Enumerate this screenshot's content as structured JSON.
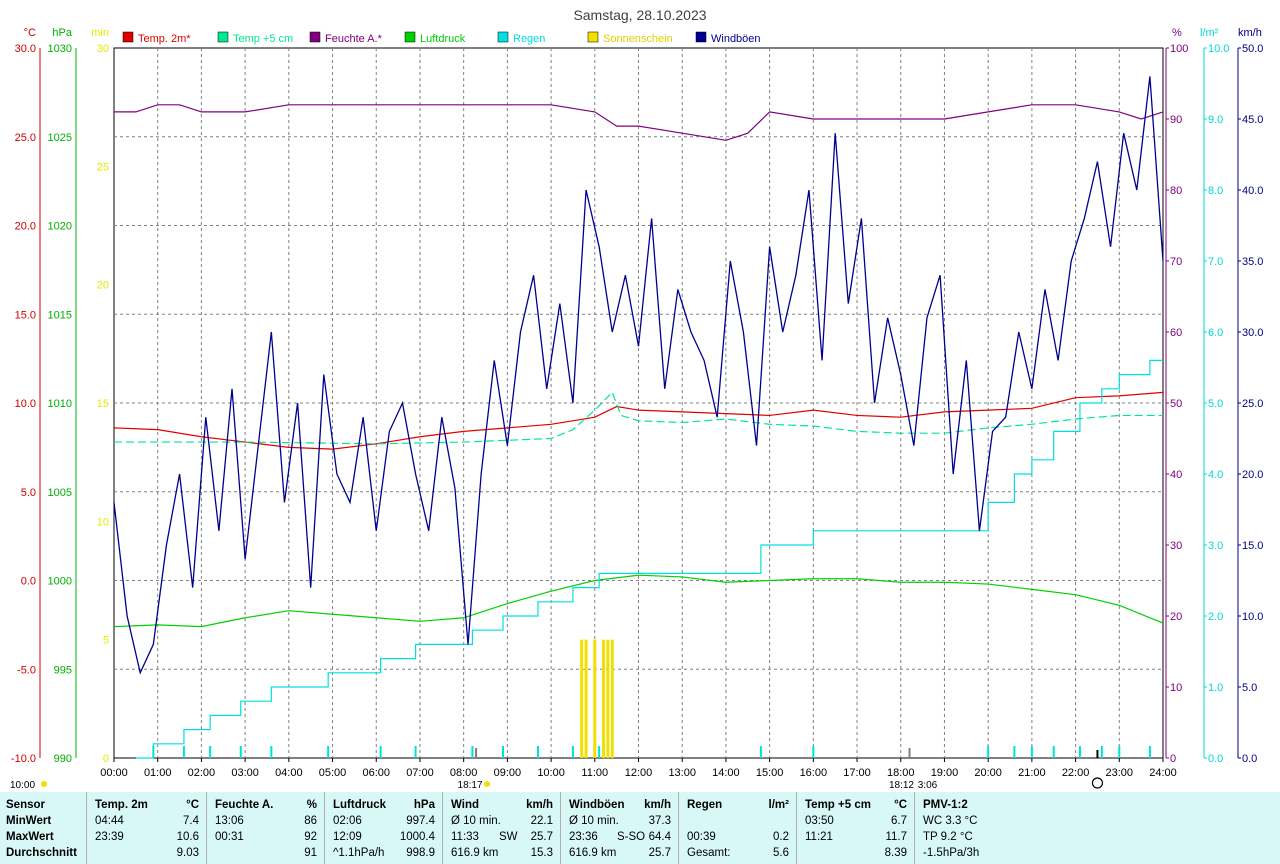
{
  "chart_data": {
    "type": "line",
    "title": "Samstag, 28.10.2023",
    "x_ticks": [
      "00:00",
      "01:00",
      "02:00",
      "03:00",
      "04:00",
      "05:00",
      "06:00",
      "07:00",
      "08:00",
      "09:00",
      "10:00",
      "11:00",
      "12:00",
      "13:00",
      "14:00",
      "15:00",
      "16:00",
      "17:00",
      "18:00",
      "19:00",
      "20:00",
      "21:00",
      "22:00",
      "23:00",
      "24:00"
    ],
    "axes": {
      "temp": {
        "unit": "°C",
        "ticks": [
          "30.0",
          "25.0",
          "20.0",
          "15.0",
          "10.0",
          "5.0",
          "0.0",
          "-5.0",
          "-10.0"
        ],
        "range": [
          -10,
          30
        ],
        "color": "#d00000"
      },
      "pressure": {
        "unit": "hPa",
        "ticks": [
          "1030",
          "1025",
          "1020",
          "1015",
          "1010",
          "1005",
          "1000",
          "995",
          "990"
        ],
        "range": [
          990,
          1030
        ],
        "color": "#00b000"
      },
      "sunshine": {
        "unit": "min",
        "ticks": [
          "30",
          "25",
          "20",
          "15",
          "10",
          "5",
          "0"
        ],
        "range": [
          0,
          30
        ],
        "color": "#e8e800"
      },
      "humidity": {
        "unit": "%",
        "ticks": [
          "100",
          "90",
          "80",
          "70",
          "60",
          "50",
          "40",
          "30",
          "20",
          "10",
          "0"
        ],
        "range": [
          0,
          100
        ],
        "color": "#800080"
      },
      "rain": {
        "unit": "l/m²",
        "ticks": [
          "10.0",
          "9.0",
          "8.0",
          "7.0",
          "6.0",
          "5.0",
          "4.0",
          "3.0",
          "2.0",
          "1.0",
          "0.0"
        ],
        "range": [
          0,
          10
        ],
        "color": "#00d8d8"
      },
      "wind": {
        "unit": "km/h",
        "ticks": [
          "50.0",
          "45.0",
          "40.0",
          "35.0",
          "30.0",
          "25.0",
          "20.0",
          "15.0",
          "10.0",
          "5.0",
          "0.0"
        ],
        "range": [
          0,
          50
        ],
        "color": "#000080"
      }
    },
    "legend": [
      {
        "name": "Temp. 2m*",
        "color": "#e00000"
      },
      {
        "name": "Temp +5 cm",
        "color": "#00e890"
      },
      {
        "name": "Feuchte A.*",
        "color": "#800080"
      },
      {
        "name": "Luftdruck",
        "color": "#00d000"
      },
      {
        "name": "Regen",
        "color": "#00e0e0"
      },
      {
        "name": "Sonnenschein",
        "color": "#f0e000"
      },
      {
        "name": "Windböen",
        "color": "#000090"
      }
    ],
    "series": [
      {
        "name": "Temp. 2m*",
        "axis": "temp",
        "x": [
          0,
          1,
          2,
          3,
          4,
          5,
          6,
          7,
          8,
          9,
          10,
          11,
          11.5,
          12,
          13,
          14,
          15,
          16,
          17,
          18,
          19,
          20,
          21,
          22,
          23,
          24
        ],
        "y": [
          8.6,
          8.5,
          8.1,
          7.8,
          7.5,
          7.4,
          7.7,
          8.1,
          8.4,
          8.6,
          8.8,
          9.2,
          9.8,
          9.6,
          9.5,
          9.4,
          9.3,
          9.6,
          9.3,
          9.2,
          9.5,
          9.6,
          9.7,
          10.3,
          10.4,
          10.6
        ]
      },
      {
        "name": "Temp +5 cm",
        "axis": "temp",
        "x": [
          0,
          3,
          6,
          8,
          10,
          10.5,
          11,
          11.4,
          11.6,
          12,
          13,
          14,
          15,
          16,
          17,
          18,
          19,
          20,
          21,
          22,
          23,
          24
        ],
        "y": [
          7.8,
          7.8,
          7.7,
          7.8,
          8.0,
          8.5,
          9.6,
          10.6,
          9.3,
          9.0,
          8.9,
          9.1,
          8.8,
          8.7,
          8.4,
          8.3,
          8.3,
          8.6,
          8.8,
          9.1,
          9.3,
          9.3
        ]
      },
      {
        "name": "Feuchte A.*",
        "axis": "humidity",
        "x": [
          0,
          0.5,
          1,
          1.5,
          2,
          3,
          4,
          5,
          6,
          7,
          8,
          9,
          10,
          11,
          11.5,
          12,
          13,
          14,
          14.5,
          15,
          16,
          17,
          18,
          19,
          20,
          21,
          22,
          23,
          23.5,
          24
        ],
        "y": [
          91,
          91,
          92,
          92,
          91,
          91,
          92,
          92,
          92,
          92,
          92,
          92,
          92,
          91,
          89,
          89,
          88,
          87,
          88,
          91,
          90,
          90,
          90,
          90,
          91,
          92,
          92,
          91,
          90,
          91
        ]
      },
      {
        "name": "Luftdruck",
        "axis": "pressure",
        "x": [
          0,
          1,
          2,
          3,
          4,
          5,
          6,
          7,
          8,
          9,
          10,
          11,
          12,
          13,
          14,
          15,
          16,
          17,
          18,
          19,
          20,
          21,
          22,
          23,
          24
        ],
        "y": [
          997.4,
          997.5,
          997.4,
          997.9,
          998.3,
          998.1,
          997.9,
          997.7,
          997.9,
          998.7,
          999.4,
          1000.0,
          1000.3,
          1000.2,
          999.9,
          1000.0,
          1000.1,
          1000.1,
          999.9,
          999.9,
          999.8,
          999.5,
          999.2,
          998.6,
          997.6
        ]
      },
      {
        "name": "Regen",
        "axis": "rain",
        "x": [
          0.5,
          0.9,
          1.6,
          2.2,
          2.9,
          3.6,
          4.9,
          6.1,
          6.9,
          8.2,
          8.9,
          9.7,
          10.5,
          11.1,
          12.0,
          13.0,
          14.4,
          14.8,
          16.0,
          17.0,
          18.0,
          19.0,
          19.8,
          20.0,
          20.6,
          21.0,
          21.5,
          22.1,
          22.6,
          23.0,
          23.7,
          24.0
        ],
        "y": [
          0,
          0.2,
          0.4,
          0.6,
          0.8,
          1.0,
          1.2,
          1.4,
          1.6,
          1.8,
          2.0,
          2.2,
          2.4,
          2.6,
          2.6,
          2.6,
          2.6,
          3.0,
          3.2,
          3.2,
          3.2,
          3.2,
          3.2,
          3.6,
          4.0,
          4.2,
          4.6,
          5.0,
          5.2,
          5.4,
          5.6,
          5.6
        ]
      },
      {
        "name": "Windböen",
        "axis": "wind",
        "x": [
          0,
          0.3,
          0.6,
          0.9,
          1.2,
          1.5,
          1.8,
          2.1,
          2.4,
          2.7,
          3.0,
          3.3,
          3.6,
          3.9,
          4.2,
          4.5,
          4.8,
          5.1,
          5.4,
          5.7,
          6.0,
          6.3,
          6.6,
          6.9,
          7.2,
          7.5,
          7.8,
          8.1,
          8.4,
          8.7,
          9.0,
          9.3,
          9.6,
          9.9,
          10.2,
          10.5,
          10.8,
          11.1,
          11.4,
          11.7,
          12.0,
          12.3,
          12.6,
          12.9,
          13.2,
          13.5,
          13.8,
          14.1,
          14.4,
          14.7,
          15.0,
          15.3,
          15.6,
          15.9,
          16.2,
          16.5,
          16.8,
          17.1,
          17.4,
          17.7,
          18.0,
          18.3,
          18.6,
          18.9,
          19.2,
          19.5,
          19.8,
          20.1,
          20.4,
          20.7,
          21.0,
          21.3,
          21.6,
          21.9,
          22.2,
          22.5,
          22.8,
          23.1,
          23.4,
          23.7,
          24.0
        ],
        "y": [
          18,
          10,
          6,
          8,
          15,
          20,
          12,
          24,
          16,
          26,
          14,
          22,
          30,
          18,
          25,
          12,
          27,
          20,
          18,
          24,
          16,
          23,
          25,
          20,
          16,
          24,
          19,
          8,
          20,
          28,
          22,
          30,
          34,
          26,
          32,
          25,
          40,
          36,
          30,
          34,
          29,
          38,
          26,
          33,
          30,
          28,
          24,
          35,
          30,
          22,
          36,
          30,
          34,
          40,
          28,
          44,
          32,
          38,
          25,
          31,
          27,
          22,
          31,
          34,
          20,
          28,
          16,
          23,
          24,
          30,
          26,
          33,
          28,
          35,
          38,
          42,
          36,
          44,
          40,
          48,
          35
        ]
      }
    ],
    "sunshine_bars": {
      "x": [
        10.7,
        10.8,
        11.0,
        11.2,
        11.3,
        11.4
      ],
      "y": [
        5,
        5,
        5,
        5,
        5,
        5
      ]
    }
  },
  "markers": {
    "sunrise": "08:17",
    "sunset": "18:12",
    "sunset_bottom": "18:17",
    "sun_upper": "3:06",
    "day_start": "10:00",
    "moon_time": "22:30"
  },
  "footer": {
    "row_labels": [
      "Sensor",
      "MinWert",
      "MaxWert",
      "Durchschnitt"
    ],
    "columns": [
      {
        "title": "Temp. 2m",
        "unit": "°C",
        "min_time": "04:44",
        "min_val": "7.4",
        "max_time": "23:39",
        "max_val": "10.6",
        "avg_label": "",
        "avg_val": "9.03"
      },
      {
        "title": "Feuchte A.",
        "unit": "%",
        "min_time": "13:06",
        "min_val": "86",
        "max_time": "00:31",
        "max_val": "92",
        "avg_label": "",
        "avg_val": "91"
      },
      {
        "title": "Luftdruck",
        "unit": "hPa",
        "min_time": "02:06",
        "min_val": "997.4",
        "max_time": "12:09",
        "max_val": "1000.4",
        "avg_label": "^1.1hPa/h",
        "avg_val": "998.9"
      },
      {
        "title": "Wind",
        "unit": "km/h",
        "min_time": "Ø 10 min.",
        "min_val": "22.1",
        "max_time": "11:33",
        "max_mid": "SW",
        "max_val": "25.7",
        "avg_label": "616.9 km",
        "avg_val": "15.3"
      },
      {
        "title": "Windböen",
        "unit": "km/h",
        "min_time": "Ø 10 min.",
        "min_val": "37.3",
        "max_time": "23:36",
        "max_mid": "S-SO",
        "max_val": "64.4",
        "avg_label": "616.9 km",
        "avg_val": "25.7"
      },
      {
        "title": "Regen",
        "unit": "l/m²",
        "min_time": "",
        "min_val": "",
        "max_time": "00:39",
        "max_val": "0.2",
        "avg_label": "Gesamt:",
        "avg_val": "5.6"
      },
      {
        "title": "Temp +5 cm",
        "unit": "°C",
        "min_time": "03:50",
        "min_val": "6.7",
        "max_time": "11:21",
        "max_val": "11.7",
        "avg_label": "",
        "avg_val": "8.39"
      },
      {
        "title": "PMV-1:2",
        "unit": "",
        "min_time": "WC 3.3 °C",
        "min_val": "",
        "max_time": "TP 9.2 °C",
        "max_val": "",
        "avg_label": "-1.5hPa/3h",
        "avg_val": ""
      }
    ]
  }
}
